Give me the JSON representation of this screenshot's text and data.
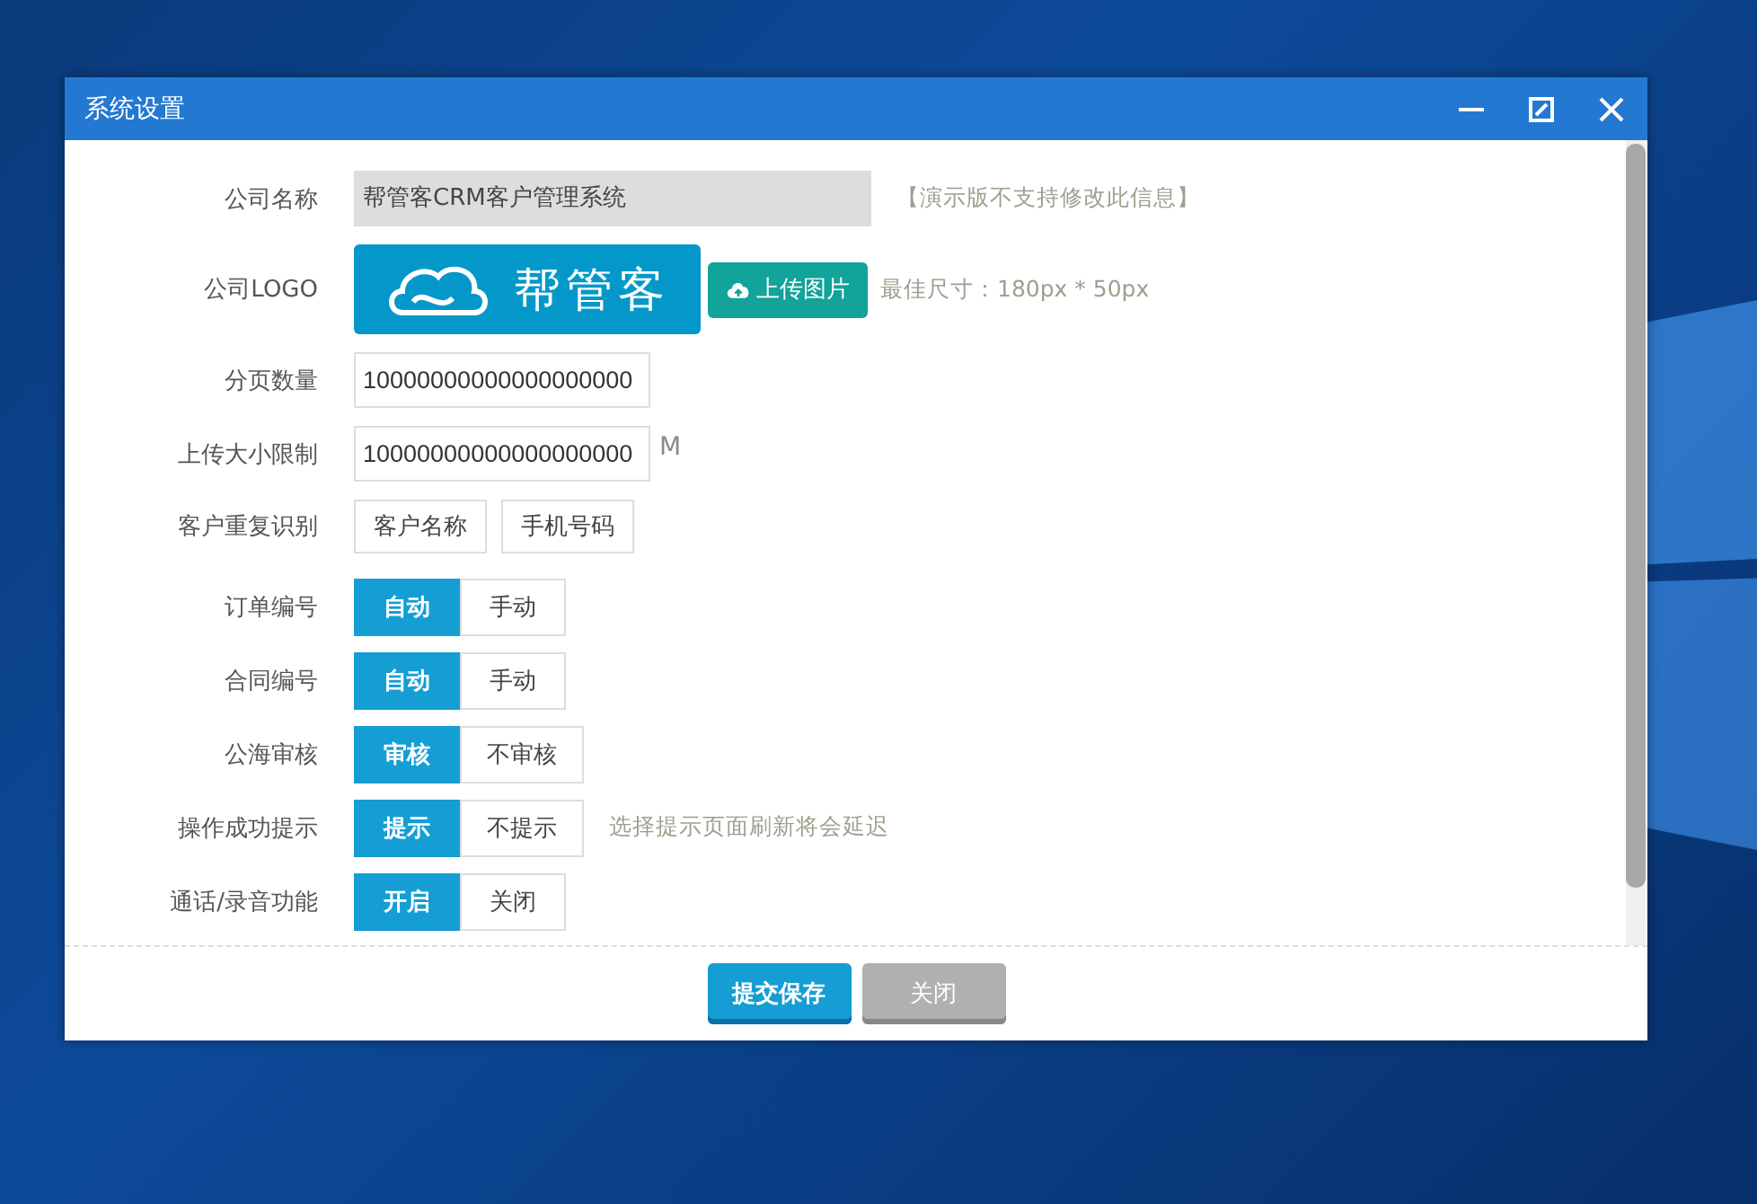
{
  "window": {
    "title": "系统设置"
  },
  "fields": [
    {
      "kind": "readonly",
      "label": "公司名称",
      "value": "帮管客CRM客户管理系统",
      "note": "【演示版不支持修改此信息】"
    },
    {
      "kind": "logo",
      "label": "公司LOGO",
      "logo_text": "帮管客",
      "button": "上传图片",
      "note": "最佳尺寸：180px * 50px"
    },
    {
      "kind": "input",
      "label": "分页数量",
      "value": "10000000000000000000"
    },
    {
      "kind": "input",
      "label": "上传大小限制",
      "value": "10000000000000000000",
      "unit": "M"
    },
    {
      "kind": "buttons",
      "label": "客户重复识别",
      "options": [
        {
          "label": "客户名称",
          "selected": false
        },
        {
          "label": "手机号码",
          "selected": false
        }
      ]
    },
    {
      "kind": "segmented",
      "label": "订单编号",
      "options": [
        {
          "label": "自动",
          "selected": true
        },
        {
          "label": "手动",
          "selected": false
        }
      ]
    },
    {
      "kind": "segmented",
      "label": "合同编号",
      "options": [
        {
          "label": "自动",
          "selected": true
        },
        {
          "label": "手动",
          "selected": false
        }
      ]
    },
    {
      "kind": "segmented",
      "label": "公海审核",
      "options": [
        {
          "label": "审核",
          "selected": true
        },
        {
          "label": "不审核",
          "selected": false
        }
      ]
    },
    {
      "kind": "segmented",
      "label": "操作成功提示",
      "options": [
        {
          "label": "提示",
          "selected": true
        },
        {
          "label": "不提示",
          "selected": false
        }
      ],
      "note": "选择提示页面刷新将会延迟"
    },
    {
      "kind": "segmented",
      "label": "通话/录音功能",
      "options": [
        {
          "label": "开启",
          "selected": true
        },
        {
          "label": "关闭",
          "selected": false
        }
      ]
    }
  ],
  "footer": {
    "buttons": [
      {
        "label": "提交保存",
        "kind": "primary"
      },
      {
        "label": "关闭",
        "kind": "secondary"
      }
    ]
  }
}
